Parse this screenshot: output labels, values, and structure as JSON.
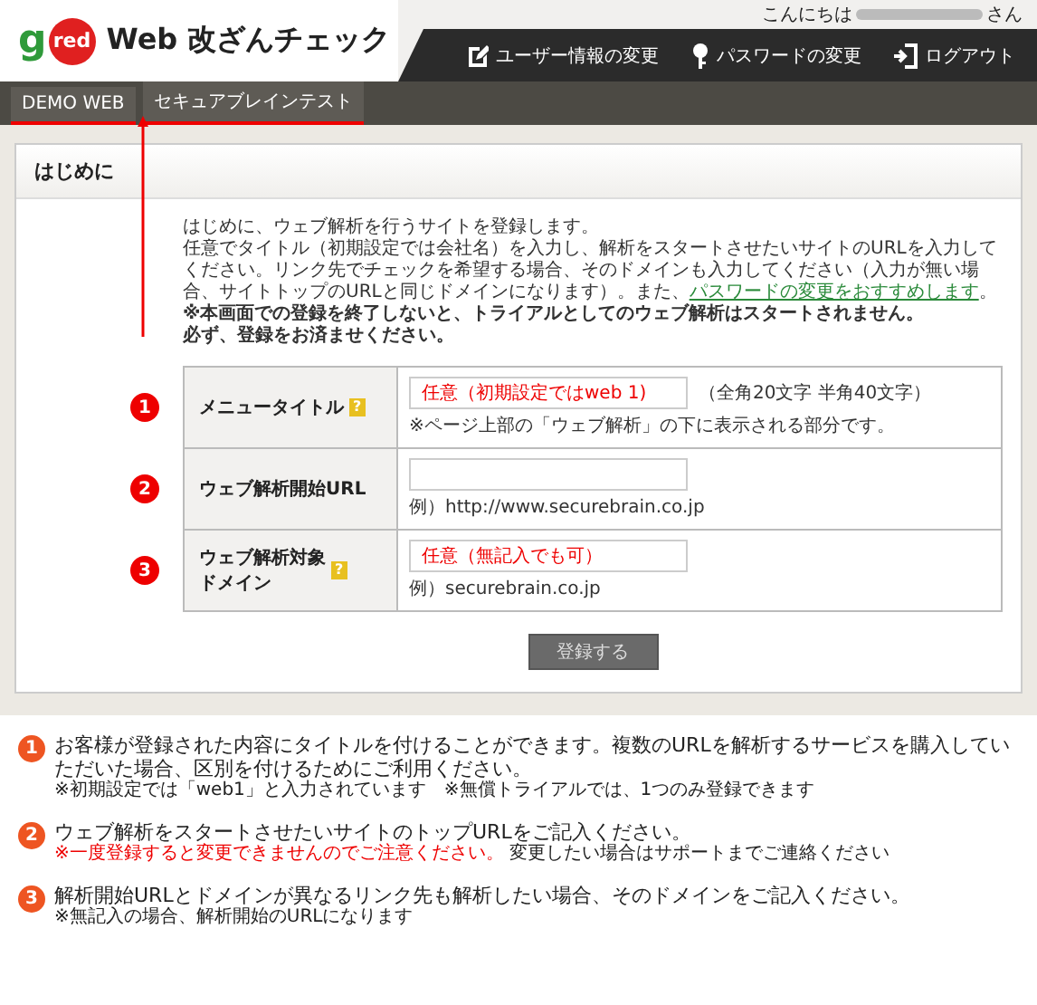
{
  "header": {
    "logo_letter": "g",
    "logo_word": "red",
    "title": "Web 改ざんチェック",
    "greeting": "こんにちは",
    "greeting_suffix": "さん",
    "nav": [
      {
        "label": "ユーザー情報の変更",
        "kind": "edit"
      },
      {
        "label": "パスワードの変更",
        "kind": "key"
      },
      {
        "label": "ログアウト",
        "kind": "logout"
      }
    ]
  },
  "tabs": [
    {
      "label": "DEMO WEB"
    },
    {
      "label": "セキュアブレインテスト"
    }
  ],
  "section": {
    "title": "はじめに",
    "intro": "はじめに、ウェブ解析を行うサイトを登録します。",
    "text_before": "任意でタイトル（初期設定では会社名）を入力し、解析をスタートさせたいサイトのURLを入力してください。リンク先でチェックを希望する場合、そのドメインも入力してください（入力が無い場合、サイトトップのURLと同じドメインになります）。また、",
    "link": "パスワードの変更をおすすめします",
    "text_after": "。",
    "warnings": [
      "※本画面での登録を終了しないと、トライアルとしてのウェブ解析はスタートされません。",
      "必ず、登録をお済ませください。"
    ]
  },
  "form": [
    {
      "number": "1",
      "label": [
        "メニュータイトル"
      ],
      "help": "?",
      "value": "任意（初期設定ではweb 1)",
      "suffix": "（全角20文字 半角40文字）",
      "note": "※ページ上部の「ウェブ解析」の下に表示される部分です。"
    },
    {
      "number": "2",
      "label": [
        "ウェブ解析開始URL"
      ],
      "note": "例）http://www.securebrain.co.jp"
    },
    {
      "number": "3",
      "label": [
        "ウェブ解析対象",
        "ドメイン"
      ],
      "help": "?",
      "value": "任意（無記入でも可）",
      "note": "例）securebrain.co.jp"
    }
  ],
  "submit": "登録する",
  "notes": [
    {
      "number": "1",
      "text": "お客様が登録された内容にタイトルを付けることができます。複数のURLを解析するサービスを購入していただいた場合、区別を付けるためにご利用ください。",
      "subnote": "※初期設定では「web1」と入力されています　※無償トライアルでは、1つのみ登録できます"
    },
    {
      "number": "2",
      "text": "ウェブ解析をスタートさせたいサイトのトップURLをご記入ください。",
      "warning": "※一度登録すると変更できませんのでご注意ください。",
      "subnote": "変更したい場合はサポートまでご連絡ください"
    },
    {
      "number": "3",
      "text": "解析開始URLとドメインが異なるリンク先も解析したい場合、そのドメインをご記入ください。",
      "subnote": "※無記入の場合、解析開始のURLになります"
    }
  ]
}
